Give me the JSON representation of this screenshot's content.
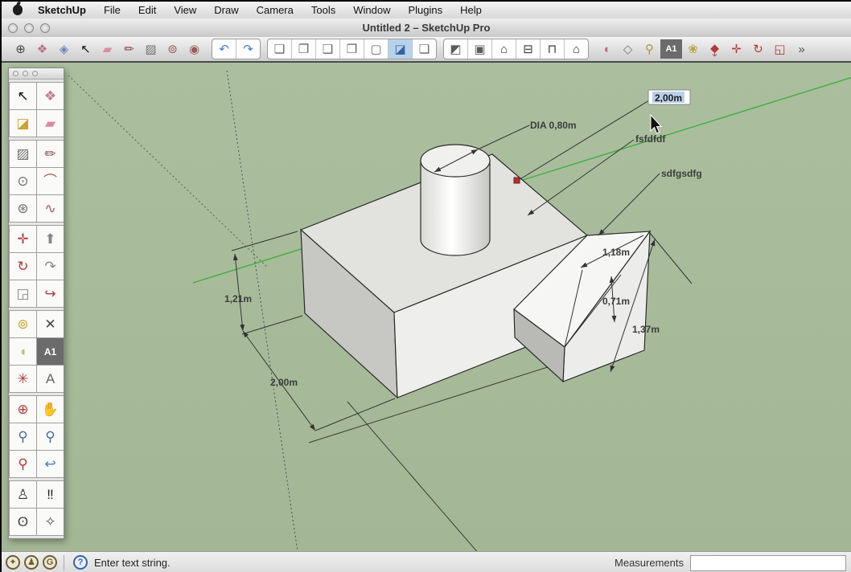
{
  "window": {
    "title": "Untitled 2 – SketchUp Pro"
  },
  "menu_bar": {
    "items": [
      "SketchUp",
      "File",
      "Edit",
      "View",
      "Draw",
      "Camera",
      "Tools",
      "Window",
      "Plugins",
      "Help"
    ]
  },
  "toolbar": {
    "groups": [
      {
        "style": "plain",
        "items": [
          {
            "name": "navigation-orbit-icon",
            "glyph": "⊕",
            "color": "#44464a"
          },
          {
            "name": "make-component-icon",
            "glyph": "❖",
            "color": "#b5708a"
          },
          {
            "name": "component-browser-icon",
            "glyph": "◈",
            "color": "#7187b5"
          },
          {
            "name": "select-icon",
            "glyph": "↖",
            "color": "#111111"
          },
          {
            "name": "eraser-icon",
            "glyph": "▰",
            "color": "#d98ca0"
          },
          {
            "name": "line-icon",
            "glyph": "✏",
            "color": "#8a4a4a"
          },
          {
            "name": "rectangle-icon",
            "glyph": "▨",
            "color": "#6f6f6f"
          },
          {
            "name": "circle-icon",
            "glyph": "⊚",
            "color": "#9a5a5a"
          },
          {
            "name": "polygon-icon",
            "glyph": "◉",
            "color": "#9a5a5a"
          }
        ]
      },
      {
        "style": "segment",
        "items": [
          {
            "name": "undo-icon",
            "glyph": "↶",
            "color": "#4a79c8"
          },
          {
            "name": "redo-icon",
            "glyph": "↷",
            "color": "#4a79c8"
          }
        ]
      },
      {
        "style": "segment",
        "items": [
          {
            "name": "style-wireframe-icon",
            "glyph": "❏",
            "color": "#666666"
          },
          {
            "name": "style-hidden-line-icon",
            "glyph": "❐",
            "color": "#666666"
          },
          {
            "name": "style-shaded-icon",
            "glyph": "❑",
            "color": "#666666"
          },
          {
            "name": "style-shaded-textures-icon",
            "glyph": "❒",
            "color": "#666666"
          },
          {
            "name": "style-monochrome-icon",
            "glyph": "▢",
            "color": "#666666"
          },
          {
            "name": "style-xray-icon",
            "glyph": "◪",
            "color": "#35649a",
            "selected": "blue"
          },
          {
            "name": "style-back-edges-icon",
            "glyph": "❏",
            "color": "#666666"
          }
        ]
      },
      {
        "style": "segment",
        "items": [
          {
            "name": "view-iso-icon",
            "glyph": "◩",
            "color": "#5a5a5a"
          },
          {
            "name": "view-top-icon",
            "glyph": "▣",
            "color": "#5a5a5a"
          },
          {
            "name": "view-front-icon",
            "glyph": "⌂",
            "color": "#3a3a3a"
          },
          {
            "name": "view-back-icon",
            "glyph": "⊟",
            "color": "#3a3a3a"
          },
          {
            "name": "view-left-icon",
            "glyph": "⊓",
            "color": "#3a3a3a"
          },
          {
            "name": "view-right-icon",
            "glyph": "⌂",
            "color": "#3a3a3a"
          }
        ]
      },
      {
        "style": "plain",
        "items": [
          {
            "name": "protractor-icon",
            "glyph": "◖",
            "color": "#c46a7a"
          },
          {
            "name": "section-plane-icon",
            "glyph": "◇",
            "color": "#7a7a7a"
          },
          {
            "name": "zoom-tool-icon",
            "glyph": "⚲",
            "color": "#a89a3a"
          },
          {
            "name": "text-tool-icon",
            "glyph": "A1",
            "color": "#ffffff",
            "selected": "dark"
          },
          {
            "name": "paint-styles-icon",
            "glyph": "❀",
            "color": "#b8a04a"
          },
          {
            "name": "sandbox-icon",
            "glyph": "⧪",
            "color": "#b03a3a"
          },
          {
            "name": "move-icon",
            "glyph": "✛",
            "color": "#b03a3a"
          },
          {
            "name": "rotate-icon",
            "glyph": "↻",
            "color": "#b03a3a"
          },
          {
            "name": "scale-window-icon",
            "glyph": "◱",
            "color": "#b03a3a"
          },
          {
            "name": "toolbar-overflow-icon",
            "glyph": "»",
            "color": "#555555"
          }
        ]
      }
    ]
  },
  "palette": {
    "groups": [
      [
        {
          "name": "select-tool-icon",
          "glyph": "↖",
          "color": "#111111"
        },
        {
          "name": "make-component-tool-icon",
          "glyph": "❖",
          "color": "#c47a94"
        },
        {
          "name": "paint-bucket-tool-icon",
          "glyph": "◪",
          "color": "#c8a43a"
        },
        {
          "name": "eraser-tool-icon",
          "glyph": "▰",
          "color": "#d98ca0"
        }
      ],
      [
        {
          "name": "rectangle-tool-icon",
          "glyph": "▨",
          "color": "#6f6f6f"
        },
        {
          "name": "line-tool-icon",
          "glyph": "✏",
          "color": "#8a4a4a"
        },
        {
          "name": "circle-tool-icon",
          "glyph": "⊙",
          "color": "#6f6f6f"
        },
        {
          "name": "arc-tool-icon",
          "glyph": "⌒",
          "color": "#a05a5a"
        },
        {
          "name": "polygon-tool-icon",
          "glyph": "⊛",
          "color": "#6f6f6f"
        },
        {
          "name": "freehand-tool-icon",
          "glyph": "∿",
          "color": "#a05a5a"
        }
      ],
      [
        {
          "name": "move-tool-icon",
          "glyph": "✛",
          "color": "#b03a3a"
        },
        {
          "name": "push-pull-tool-icon",
          "glyph": "⬆",
          "color": "#86868a"
        },
        {
          "name": "rotate-tool-icon",
          "glyph": "↻",
          "color": "#b03a3a"
        },
        {
          "name": "follow-me-tool-icon",
          "glyph": "↷",
          "color": "#86868a"
        },
        {
          "name": "scale-tool-icon",
          "glyph": "◲",
          "color": "#86868a"
        },
        {
          "name": "offset-tool-icon",
          "glyph": "↪",
          "color": "#b03a3a"
        }
      ],
      [
        {
          "name": "tape-measure-tool-icon",
          "glyph": "⊚",
          "color": "#c8a43a"
        },
        {
          "name": "dimension-tool-icon",
          "glyph": "✕",
          "color": "#444444"
        },
        {
          "name": "protractor-tool-icon",
          "glyph": "◖",
          "color": "#c8c06a"
        },
        {
          "name": "text-tool-palette-icon",
          "glyph": "A1",
          "color": "#ffffff",
          "selected": "dark"
        },
        {
          "name": "axes-tool-icon",
          "glyph": "✳",
          "color": "#b03a3a"
        },
        {
          "name": "3d-text-tool-icon",
          "glyph": "A",
          "color": "#666666"
        }
      ],
      [
        {
          "name": "orbit-tool-icon",
          "glyph": "⊕",
          "color": "#b03a3a"
        },
        {
          "name": "pan-tool-icon",
          "glyph": "✋",
          "color": "#555555"
        },
        {
          "name": "zoom-palette-icon",
          "glyph": "⚲",
          "color": "#4a6a9a"
        },
        {
          "name": "zoom-window-tool-icon",
          "glyph": "⚲",
          "color": "#4a6a9a"
        },
        {
          "name": "zoom-extents-tool-icon",
          "glyph": "⚲",
          "color": "#b03a3a"
        },
        {
          "name": "previous-view-tool-icon",
          "glyph": "↩",
          "color": "#4a79c8"
        }
      ],
      [
        {
          "name": "position-camera-tool-icon",
          "glyph": "♙",
          "color": "#333333"
        },
        {
          "name": "walk-tool-icon",
          "glyph": "‼",
          "color": "#222222"
        },
        {
          "name": "look-around-tool-icon",
          "glyph": "ʘ",
          "color": "#444444"
        },
        {
          "name": "section-compass-tool-icon",
          "glyph": "✧",
          "color": "#555555"
        }
      ]
    ]
  },
  "canvas": {
    "labels": {
      "dia": "DIA 0,80m",
      "text_edit": "2,00m",
      "note1": "fsfdfdf",
      "note2": "sdfgsdfg",
      "dim_118": "1,18m",
      "dim_071": "0,71m",
      "dim_137": "1,37m",
      "dim_121": "1,21m",
      "dim_200": "2,00m"
    }
  },
  "status_bar": {
    "icons": [
      {
        "name": "credit-bulb-icon",
        "glyph": "✦",
        "kind": "tan"
      },
      {
        "name": "user-credit-icon",
        "glyph": "♟",
        "kind": "tan"
      },
      {
        "name": "geo-g-icon",
        "glyph": "G",
        "kind": "tan"
      },
      {
        "name": "help-icon",
        "glyph": "?",
        "kind": "help"
      }
    ],
    "message": "Enter text string.",
    "measurements_label": "Measurements",
    "measurements_value": ""
  },
  "colors": {
    "canvas_green": "#a7bb9a",
    "axis_green": "#3fae3f",
    "selection_blue": "#b9cfe9",
    "marker_red": "#a83030",
    "edge_dark": "#2b2b2b"
  }
}
